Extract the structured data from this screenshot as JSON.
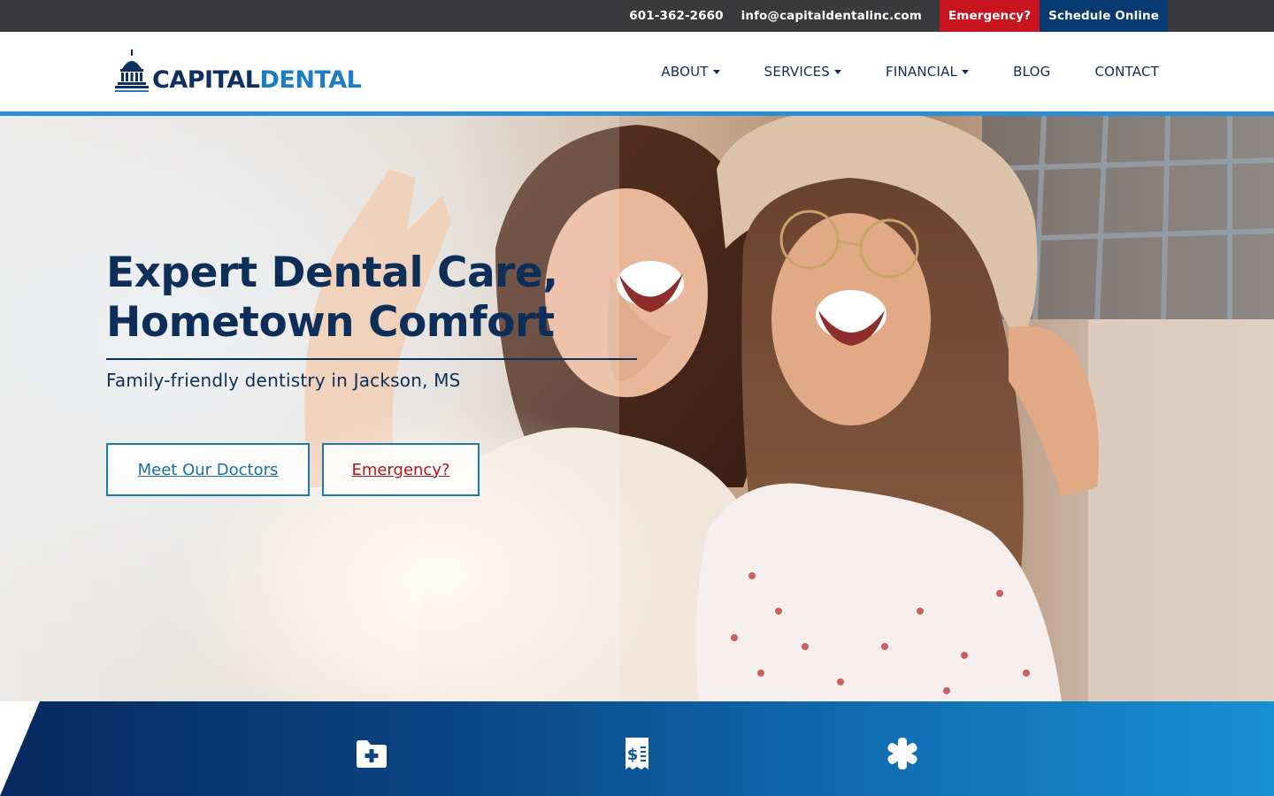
{
  "topbar": {
    "phone": "601-362-2660",
    "email": "info@capitaldentalinc.com",
    "emergency_label": "Emergency?",
    "schedule_label": "Schedule Online"
  },
  "logo": {
    "word1": "CAPITAL",
    "word2": "DENTAL"
  },
  "nav": {
    "items": [
      {
        "label": "ABOUT",
        "dropdown": true
      },
      {
        "label": "SERVICES",
        "dropdown": true
      },
      {
        "label": "FINANCIAL",
        "dropdown": true
      },
      {
        "label": "BLOG",
        "dropdown": false
      },
      {
        "label": "CONTACT",
        "dropdown": false
      }
    ]
  },
  "hero": {
    "title_line1": "Expert Dental Care,",
    "title_line2": "Hometown Comfort",
    "subtitle": "Family-friendly dentistry in Jackson, MS",
    "button_doctors": "Meet Our Doctors",
    "button_emergency": "Emergency?",
    "image_subject": "two smiling women outdoors"
  },
  "band": {
    "icons": [
      "medical-folder-icon",
      "dollar-receipt-icon",
      "asterisk-icon"
    ]
  },
  "colors": {
    "navy": "#0e2e5a",
    "brand_blue": "#1e7cc4",
    "accent_rule": "#2c8fd6",
    "emergency_red": "#c8141e",
    "schedule_navy": "#073a72",
    "topbar": "#3a3a3c"
  }
}
